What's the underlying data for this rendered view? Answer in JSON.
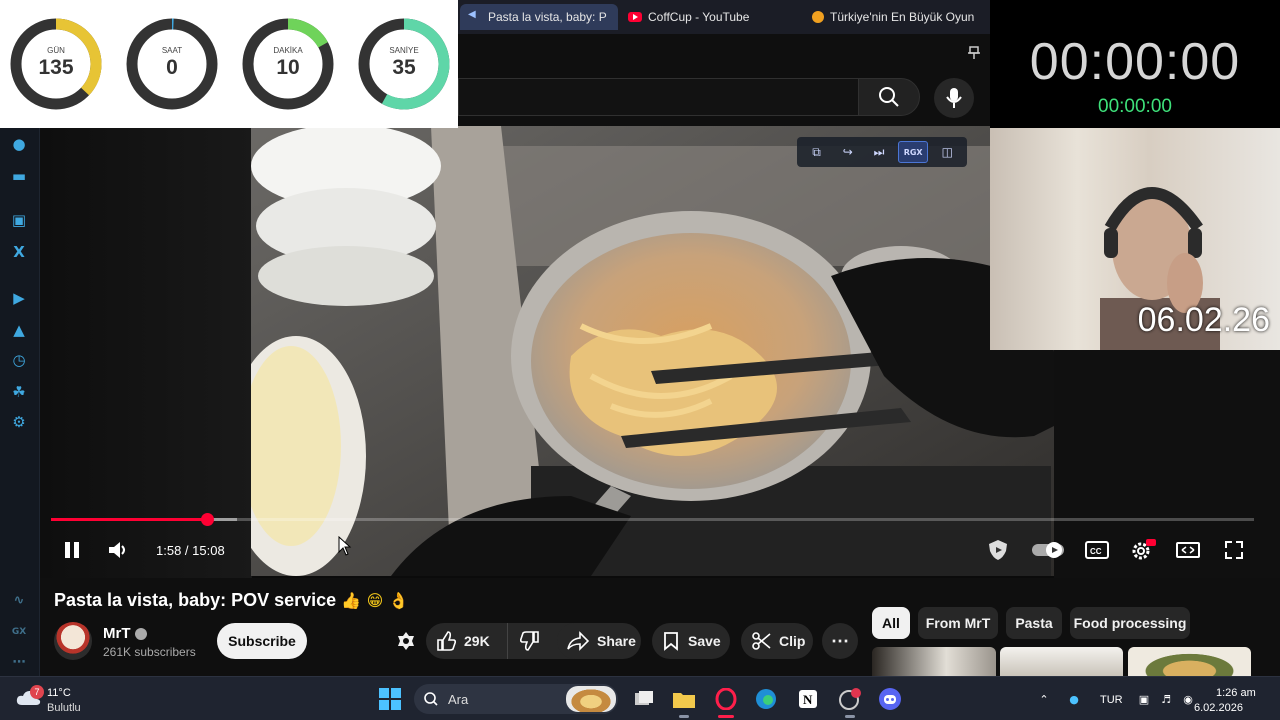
{
  "countdown": [
    {
      "label": "GÜN",
      "value": "135",
      "fraction": 0.37,
      "color": "#e7c435"
    },
    {
      "label": "SAAT",
      "value": "0",
      "fraction": 0.0,
      "color": "#3fa8e0"
    },
    {
      "label": "DAKİKA",
      "value": "10",
      "fraction": 0.17,
      "color": "#6fd35a"
    },
    {
      "label": "SANİYE",
      "value": "35",
      "fraction": 0.58,
      "color": "#5fd6a8"
    }
  ],
  "browser": {
    "tabs": [
      {
        "title": "Pasta la vista, baby: P",
        "active": true,
        "icon": "speaker-icon"
      },
      {
        "title": "CoffCup - YouTube",
        "active": false,
        "icon": "youtube-icon"
      },
      {
        "title": "Türkiye'nin En Büyük Oyun",
        "active": false,
        "icon": "game-icon"
      }
    ]
  },
  "stopwatch": {
    "main": "00:00:00",
    "sub": "00:00:00"
  },
  "webcam": {
    "date": "06.02.26"
  },
  "player": {
    "time": "1:58 / 15:08",
    "progress_played": 0.13,
    "progress_loaded": 0.155,
    "pip_toolbar": [
      "pop-out-icon",
      "exit-icon",
      "next-icon",
      "GX",
      "split-icon"
    ]
  },
  "video": {
    "title": "Pasta la vista, baby: POV service",
    "title_emojis": "👍 😁 👌",
    "channel": "MrT",
    "subscribers": "261K subscribers",
    "subscribe_label": "Subscribe",
    "likes": "29K",
    "share_label": "Share",
    "save_label": "Save",
    "clip_label": "Clip"
  },
  "chips": [
    "All",
    "From MrT",
    "Pasta",
    "Food processing"
  ],
  "taskbar": {
    "weather_temp": "11°C",
    "weather_desc": "Bulutlu",
    "weather_badge": "7",
    "search_placeholder": "Ara",
    "language": "TUR",
    "time": "1:26 am",
    "date": "6.02.2026"
  }
}
